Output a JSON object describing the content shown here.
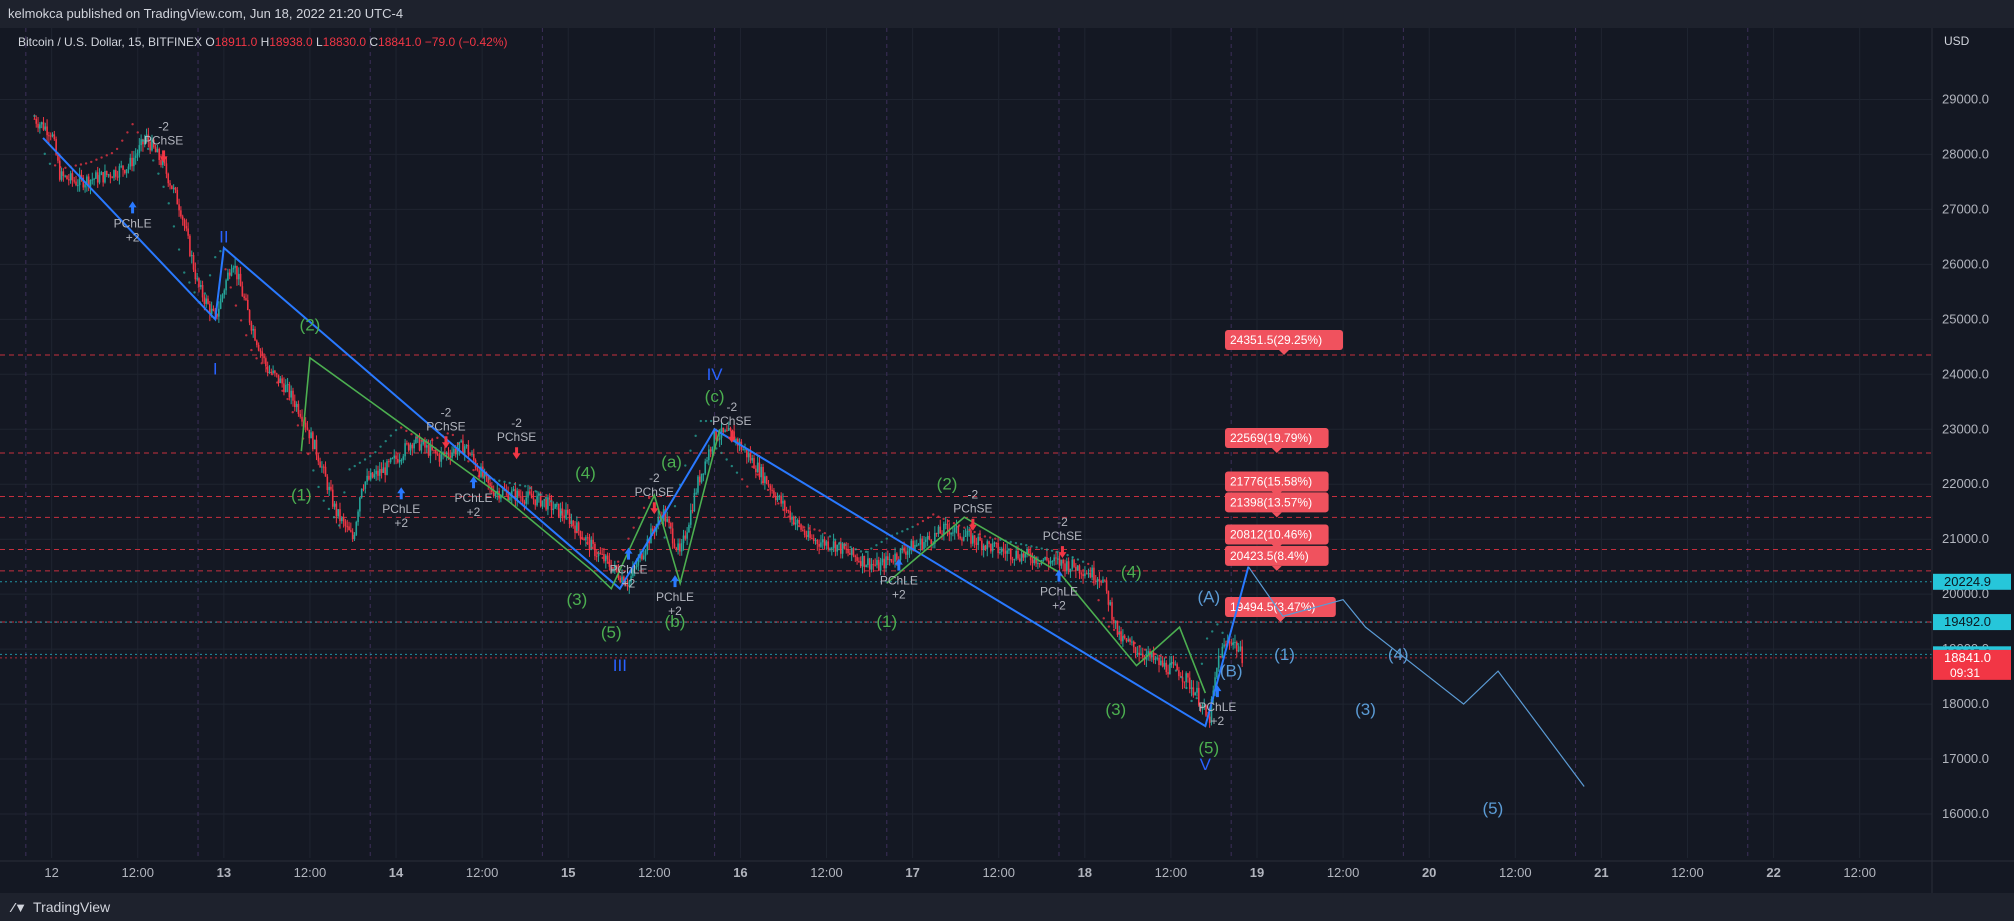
{
  "header": {
    "published": "kelmokca published on TradingView.com, Jun 18, 2022 21:20 UTC-4"
  },
  "symbol": {
    "name": "Bitcoin / U.S. Dollar, 15, BITFINEX",
    "ohlc": [
      {
        "k": "O",
        "v": "18911.0"
      },
      {
        "k": "H",
        "v": "18938.0"
      },
      {
        "k": "L",
        "v": "18830.0"
      },
      {
        "k": "C",
        "v": "18841.0"
      }
    ],
    "change": "−79.0 (−0.42%)"
  },
  "footer": {
    "brand": "TradingView"
  },
  "colors": {
    "bg": "#141823",
    "grid": "#1f2430",
    "blue": "#2962ff",
    "green": "#4caf50",
    "red": "#f23645",
    "cyan": "#26c6da",
    "teal": "#26a69a",
    "wave_blue": "#2979ff",
    "label_blue": "#5b9bd5",
    "target": "#f0525e"
  },
  "chart_data": {
    "type": "candlestick",
    "currency": "USD",
    "ylim": [
      15200,
      30300
    ],
    "y_ticks": [
      "16000.0",
      "17000.0",
      "18000.0",
      "19000.0",
      "20000.0",
      "21000.0",
      "22000.0",
      "23000.0",
      "24000.0",
      "25000.0",
      "26000.0",
      "27000.0",
      "28000.0",
      "29000.0"
    ],
    "x_ticks": [
      "12",
      "12:00",
      "13",
      "12:00",
      "14",
      "12:00",
      "15",
      "12:00",
      "16",
      "12:00",
      "17",
      "12:00",
      "18",
      "12:00",
      "19",
      "12:00",
      "20",
      "12:00",
      "21",
      "12:00",
      "22",
      "12:00"
    ],
    "x_major_ticks": [
      "13",
      "14",
      "15",
      "16",
      "17",
      "18",
      "19",
      "20",
      "21",
      "22"
    ],
    "price_series": [
      [
        11.9,
        28650
      ],
      [
        12.0,
        28400
      ],
      [
        12.05,
        27600
      ],
      [
        12.15,
        27500
      ],
      [
        12.3,
        27600
      ],
      [
        12.45,
        27800
      ],
      [
        12.55,
        28300
      ],
      [
        12.65,
        27800
      ],
      [
        12.75,
        27000
      ],
      [
        12.85,
        25600
      ],
      [
        12.95,
        25000
      ],
      [
        13.05,
        26100
      ],
      [
        13.15,
        25000
      ],
      [
        13.25,
        24100
      ],
      [
        13.35,
        23800
      ],
      [
        13.45,
        23300
      ],
      [
        13.55,
        22500
      ],
      [
        13.65,
        21500
      ],
      [
        13.75,
        21000
      ],
      [
        13.8,
        22000
      ],
      [
        13.95,
        22300
      ],
      [
        14.1,
        22800
      ],
      [
        14.25,
        22500
      ],
      [
        14.4,
        22700
      ],
      [
        14.55,
        21900
      ],
      [
        14.7,
        21800
      ],
      [
        14.85,
        21700
      ],
      [
        15.0,
        21400
      ],
      [
        15.15,
        20800
      ],
      [
        15.25,
        20500
      ],
      [
        15.35,
        20200
      ],
      [
        15.45,
        20900
      ],
      [
        15.55,
        21500
      ],
      [
        15.65,
        20700
      ],
      [
        15.75,
        22000
      ],
      [
        15.85,
        22900
      ],
      [
        15.95,
        22900
      ],
      [
        16.1,
        22300
      ],
      [
        16.25,
        21600
      ],
      [
        16.4,
        21000
      ],
      [
        16.55,
        20900
      ],
      [
        16.65,
        20700
      ],
      [
        16.8,
        20500
      ],
      [
        16.95,
        20800
      ],
      [
        17.1,
        21000
      ],
      [
        17.2,
        21200
      ],
      [
        17.35,
        21000
      ],
      [
        17.5,
        20800
      ],
      [
        17.65,
        20700
      ],
      [
        17.8,
        20600
      ],
      [
        17.95,
        20500
      ],
      [
        18.1,
        20300
      ],
      [
        18.2,
        19200
      ],
      [
        18.3,
        19000
      ],
      [
        18.45,
        18700
      ],
      [
        18.55,
        18600
      ],
      [
        18.65,
        18200
      ],
      [
        18.72,
        17650
      ],
      [
        18.78,
        18900
      ],
      [
        18.85,
        19200
      ],
      [
        18.92,
        18841
      ]
    ],
    "target_levels": [
      {
        "price": 24351.5,
        "label": "24351.5(29.25%)"
      },
      {
        "price": 22569,
        "label": "22569(19.79%)"
      },
      {
        "price": 21776,
        "label": "21776(15.58%)"
      },
      {
        "price": 21398,
        "label": "21398(13.57%)"
      },
      {
        "price": 20812,
        "label": "20812(10.46%)"
      },
      {
        "price": 20423.5,
        "label": "20423.5(8.4%)"
      },
      {
        "price": 19494.5,
        "label": "19494.5(3.47%)"
      }
    ],
    "price_tags": [
      {
        "price": 20224.9,
        "label": "20224.9",
        "color": "#26c6da"
      },
      {
        "price": 19492.0,
        "label": "19492.0",
        "color": "#26c6da"
      },
      {
        "price": 18905.6,
        "label": "18905.6",
        "color": "#26c6da"
      },
      {
        "price": 18841.0,
        "label": "18841.0",
        "sub": "09:31",
        "color": "#f23645"
      }
    ],
    "blue_zigzag": [
      [
        11.95,
        28300
      ],
      [
        12.95,
        25000
      ],
      [
        13.0,
        26300
      ],
      [
        15.3,
        20100
      ],
      [
        15.85,
        23000
      ],
      [
        18.7,
        17600
      ],
      [
        18.95,
        20500
      ]
    ],
    "green_zigzag_1": [
      [
        13.45,
        22600
      ],
      [
        13.5,
        24300
      ],
      [
        14.65,
        21700
      ],
      [
        15.15,
        20400
      ],
      [
        15.25,
        20100
      ],
      [
        15.5,
        21800
      ],
      [
        15.65,
        20200
      ],
      [
        15.88,
        23000
      ]
    ],
    "green_zigzag_2": [
      [
        16.85,
        20200
      ],
      [
        17.3,
        21400
      ],
      [
        17.85,
        20400
      ],
      [
        18.3,
        18700
      ],
      [
        18.55,
        19400
      ],
      [
        18.7,
        18200
      ]
    ],
    "projection": [
      [
        18.95,
        20500
      ],
      [
        19.15,
        19600
      ],
      [
        19.5,
        19900
      ],
      [
        19.63,
        19400
      ],
      [
        20.2,
        18000
      ],
      [
        20.4,
        18600
      ],
      [
        20.9,
        16500
      ]
    ],
    "wave_labels": [
      {
        "t": "I",
        "x": 12.95,
        "y": 24000,
        "c": "blue"
      },
      {
        "t": "II",
        "x": 13.0,
        "y": 26400,
        "c": "blue"
      },
      {
        "t": "III",
        "x": 15.3,
        "y": 18600,
        "c": "blue"
      },
      {
        "t": "IV",
        "x": 15.85,
        "y": 23900,
        "c": "blue"
      },
      {
        "t": "V",
        "x": 18.7,
        "y": 16800,
        "c": "blue"
      },
      {
        "t": "(1)",
        "x": 13.45,
        "y": 21700,
        "c": "green"
      },
      {
        "t": "(2)",
        "x": 13.5,
        "y": 24800,
        "c": "green"
      },
      {
        "t": "(3)",
        "x": 15.05,
        "y": 19800,
        "c": "green"
      },
      {
        "t": "(4)",
        "x": 15.1,
        "y": 22100,
        "c": "green"
      },
      {
        "t": "(5)",
        "x": 15.25,
        "y": 19200,
        "c": "green"
      },
      {
        "t": "(a)",
        "x": 15.6,
        "y": 22300,
        "c": "green"
      },
      {
        "t": "(b)",
        "x": 15.62,
        "y": 19400,
        "c": "green"
      },
      {
        "t": "(c)",
        "x": 15.85,
        "y": 23500,
        "c": "green"
      },
      {
        "t": "(1)",
        "x": 16.85,
        "y": 19400,
        "c": "green"
      },
      {
        "t": "(2)",
        "x": 17.2,
        "y": 21900,
        "c": "green"
      },
      {
        "t": "(3)",
        "x": 18.18,
        "y": 17800,
        "c": "green"
      },
      {
        "t": "(4)",
        "x": 18.27,
        "y": 20300,
        "c": "green"
      },
      {
        "t": "(5)",
        "x": 18.72,
        "y": 17100,
        "c": "green"
      },
      {
        "t": "(A)",
        "x": 18.72,
        "y": 19850,
        "c": "light"
      },
      {
        "t": "(B)",
        "x": 18.85,
        "y": 18500,
        "c": "light"
      },
      {
        "t": "(1)",
        "x": 19.16,
        "y": 18800,
        "c": "light"
      },
      {
        "t": "(3)",
        "x": 19.63,
        "y": 17800,
        "c": "light"
      },
      {
        "t": "(4)",
        "x": 19.82,
        "y": 18800,
        "c": "light"
      },
      {
        "t": "(5)",
        "x": 20.37,
        "y": 16000,
        "c": "light"
      }
    ],
    "signals": [
      {
        "type": "LE",
        "label": "PChLE",
        "sub": "+2",
        "x": 12.47,
        "y": 27000
      },
      {
        "type": "SE",
        "label": "PChSE",
        "sub": "-2",
        "x": 12.65,
        "y": 28000
      },
      {
        "type": "LE",
        "label": "PChLE",
        "sub": "+2",
        "x": 14.03,
        "y": 21800
      },
      {
        "type": "SE",
        "label": "PChSE",
        "sub": "-2",
        "x": 14.29,
        "y": 22800
      },
      {
        "type": "LE",
        "label": "PChLE",
        "sub": "+2",
        "x": 14.45,
        "y": 22000
      },
      {
        "type": "SE",
        "label": "PChSE",
        "sub": "-2",
        "x": 14.7,
        "y": 22600
      },
      {
        "type": "LE",
        "label": "PChLE",
        "sub": "+2",
        "x": 15.35,
        "y": 20700
      },
      {
        "type": "SE",
        "label": "PChSE",
        "sub": "-2",
        "x": 15.5,
        "y": 21600
      },
      {
        "type": "LE",
        "label": "PChLE",
        "sub": "+2",
        "x": 15.62,
        "y": 20200
      },
      {
        "type": "SE",
        "label": "PChSE",
        "sub": "-2",
        "x": 15.95,
        "y": 22900
      },
      {
        "type": "LE",
        "label": "PChLE",
        "sub": "+2",
        "x": 16.92,
        "y": 20500
      },
      {
        "type": "SE",
        "label": "PChSE",
        "sub": "-2",
        "x": 17.35,
        "y": 21300
      },
      {
        "type": "LE",
        "label": "PChLE",
        "sub": "+2",
        "x": 17.85,
        "y": 20300
      },
      {
        "type": "SE",
        "label": "PChSE",
        "sub": "-2",
        "x": 17.87,
        "y": 20800
      },
      {
        "type": "LE",
        "label": "PChLE",
        "sub": "+2",
        "x": 18.77,
        "y": 18200
      }
    ]
  }
}
